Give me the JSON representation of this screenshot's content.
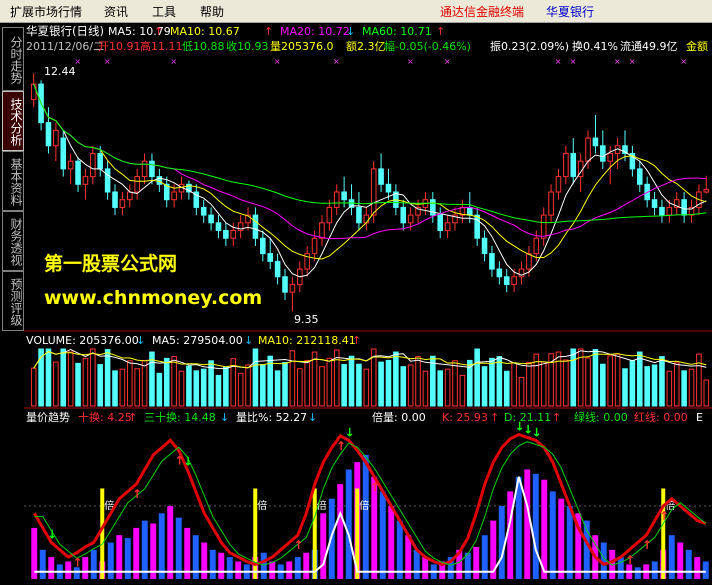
{
  "menu": {
    "items": [
      "扩展市场行情",
      "资讯",
      "工具",
      "帮助"
    ],
    "brand": "通达信金融终端",
    "stock_name": "华夏银行"
  },
  "side_tabs": [
    "分时走势",
    "技术分析",
    "基本资料",
    "财务透视",
    "预测评级"
  ],
  "price_panel": {
    "title": "华夏银行(日线)",
    "ma": [
      {
        "label": "MA5: 10.79",
        "color": "#ffffff"
      },
      {
        "label": "MA10: 10.67",
        "color": "#ffff00"
      },
      {
        "label": "MA20: 10.72",
        "color": "#ff00ff"
      },
      {
        "label": "MA60: 10.71",
        "color": "#00ff00"
      }
    ],
    "info": {
      "date": "2011/12/06/二",
      "open": "开10.91",
      "high": "高11.11",
      "low": "低10.88",
      "close": "收10.93",
      "volume": "量205376.0",
      "amount": "额2.3亿",
      "change": "幅-0.05(-0.46%)",
      "amplitude": "振0.23(2.09%)",
      "turnover": "换0.41%",
      "float": "流通49.9亿",
      "amount_label": "金额"
    },
    "high_marker": "12.44",
    "low_marker": "9.35",
    "watermark_line1": "第一股票公式网",
    "watermark_line2": "www.chnmoney.com"
  },
  "volume_panel": {
    "vol": "VOLUME: 205376.00",
    "ma5": "MA5: 279504.00",
    "ma10": "MA10: 212118.41"
  },
  "indicator_panel": {
    "name": "量价趋势",
    "shi_huan": "十换: 4.25",
    "sanshi_huan": "三十换: 14.48",
    "liang_bi": "量比%: 52.27",
    "bei_liang": "倍量: 0.00",
    "k": "K: 25.93",
    "d": "D: 21.11",
    "green_line": "绿线: 0.00",
    "red_line": "红线: 0.00",
    "tail": "E",
    "bei_marker": "倍"
  },
  "chart_data": {
    "type": "candlestick",
    "price_range": [
      9.2,
      12.6
    ],
    "candles": [
      [
        12.1,
        12.44,
        12.0,
        12.3
      ],
      [
        12.3,
        12.35,
        11.7,
        11.8
      ],
      [
        11.8,
        12.0,
        11.4,
        11.5
      ],
      [
        11.5,
        11.8,
        11.3,
        11.7
      ],
      [
        11.6,
        11.7,
        11.1,
        11.2
      ],
      [
        11.2,
        11.4,
        11.0,
        11.3
      ],
      [
        11.3,
        11.35,
        10.9,
        11.0
      ],
      [
        11.0,
        11.2,
        10.8,
        11.1
      ],
      [
        11.1,
        11.5,
        11.0,
        11.4
      ],
      [
        11.4,
        11.5,
        11.1,
        11.2
      ],
      [
        11.2,
        11.3,
        10.8,
        10.9
      ],
      [
        10.9,
        11.0,
        10.6,
        10.7
      ],
      [
        10.7,
        10.9,
        10.6,
        10.8
      ],
      [
        10.8,
        11.0,
        10.7,
        10.9
      ],
      [
        10.9,
        11.2,
        10.8,
        11.1
      ],
      [
        11.1,
        11.4,
        11.0,
        11.3
      ],
      [
        11.3,
        11.4,
        11.0,
        11.1
      ],
      [
        11.1,
        11.2,
        10.9,
        11.0
      ],
      [
        11.0,
        11.1,
        10.7,
        10.8
      ],
      [
        10.8,
        11.0,
        10.7,
        10.9
      ],
      [
        10.9,
        11.1,
        10.8,
        11.0
      ],
      [
        11.0,
        11.05,
        10.8,
        10.9
      ],
      [
        10.9,
        11.0,
        10.6,
        10.7
      ],
      [
        10.7,
        10.8,
        10.5,
        10.6
      ],
      [
        10.6,
        10.7,
        10.4,
        10.5
      ],
      [
        10.5,
        10.6,
        10.3,
        10.4
      ],
      [
        10.4,
        10.5,
        10.2,
        10.3
      ],
      [
        10.3,
        10.5,
        10.2,
        10.4
      ],
      [
        10.4,
        10.6,
        10.3,
        10.5
      ],
      [
        10.5,
        10.7,
        10.4,
        10.6
      ],
      [
        10.6,
        10.7,
        10.2,
        10.3
      ],
      [
        10.3,
        10.4,
        10.0,
        10.1
      ],
      [
        10.1,
        10.3,
        9.9,
        10.0
      ],
      [
        10.0,
        10.1,
        9.7,
        9.8
      ],
      [
        9.8,
        9.9,
        9.5,
        9.6
      ],
      [
        9.6,
        9.8,
        9.35,
        9.7
      ],
      [
        9.7,
        10.0,
        9.6,
        9.9
      ],
      [
        9.9,
        10.2,
        9.8,
        10.1
      ],
      [
        10.1,
        10.4,
        10.0,
        10.3
      ],
      [
        10.3,
        10.6,
        10.2,
        10.5
      ],
      [
        10.5,
        10.8,
        10.4,
        10.7
      ],
      [
        10.7,
        11.0,
        10.6,
        10.9
      ],
      [
        10.9,
        11.1,
        10.7,
        10.8
      ],
      [
        10.8,
        11.0,
        10.6,
        10.7
      ],
      [
        10.7,
        10.9,
        10.4,
        10.5
      ],
      [
        10.5,
        10.7,
        10.4,
        10.6
      ],
      [
        10.6,
        11.3,
        10.5,
        11.2
      ],
      [
        11.2,
        11.4,
        10.9,
        11.0
      ],
      [
        11.0,
        11.2,
        10.8,
        10.9
      ],
      [
        10.9,
        11.0,
        10.6,
        10.7
      ],
      [
        10.7,
        10.8,
        10.4,
        10.5
      ],
      [
        10.5,
        10.7,
        10.4,
        10.6
      ],
      [
        10.6,
        10.8,
        10.5,
        10.7
      ],
      [
        10.7,
        10.9,
        10.6,
        10.8
      ],
      [
        10.8,
        10.9,
        10.5,
        10.6
      ],
      [
        10.6,
        10.7,
        10.3,
        10.4
      ],
      [
        10.4,
        10.6,
        10.3,
        10.5
      ],
      [
        10.5,
        10.7,
        10.4,
        10.6
      ],
      [
        10.6,
        10.8,
        10.5,
        10.7
      ],
      [
        10.7,
        10.9,
        10.5,
        10.6
      ],
      [
        10.6,
        10.7,
        10.2,
        10.3
      ],
      [
        10.3,
        10.4,
        10.0,
        10.1
      ],
      [
        10.1,
        10.2,
        9.8,
        9.9
      ],
      [
        9.9,
        10.0,
        9.7,
        9.8
      ],
      [
        9.8,
        9.9,
        9.6,
        9.7
      ],
      [
        9.7,
        9.9,
        9.6,
        9.8
      ],
      [
        9.8,
        10.0,
        9.7,
        9.9
      ],
      [
        9.9,
        10.2,
        9.8,
        10.1
      ],
      [
        10.1,
        10.4,
        10.0,
        10.3
      ],
      [
        10.3,
        10.7,
        10.2,
        10.6
      ],
      [
        10.6,
        11.0,
        10.5,
        10.9
      ],
      [
        10.9,
        11.2,
        10.8,
        11.1
      ],
      [
        11.1,
        11.5,
        11.0,
        11.4
      ],
      [
        11.4,
        11.6,
        11.0,
        11.1
      ],
      [
        11.1,
        11.4,
        10.9,
        11.3
      ],
      [
        11.3,
        11.7,
        11.2,
        11.6
      ],
      [
        11.6,
        11.9,
        11.4,
        11.5
      ],
      [
        11.5,
        11.7,
        11.2,
        11.3
      ],
      [
        11.3,
        11.5,
        11.0,
        11.4
      ],
      [
        11.4,
        11.6,
        11.2,
        11.5
      ],
      [
        11.5,
        11.7,
        11.3,
        11.4
      ],
      [
        11.4,
        11.5,
        11.1,
        11.2
      ],
      [
        11.2,
        11.3,
        10.9,
        11.0
      ],
      [
        11.0,
        11.1,
        10.7,
        10.8
      ],
      [
        10.8,
        10.9,
        10.6,
        10.7
      ],
      [
        10.7,
        10.8,
        10.5,
        10.6
      ],
      [
        10.6,
        10.8,
        10.5,
        10.7
      ],
      [
        10.7,
        10.9,
        10.6,
        10.8
      ],
      [
        10.8,
        10.9,
        10.5,
        10.6
      ],
      [
        10.6,
        10.8,
        10.5,
        10.7
      ],
      [
        10.7,
        11.0,
        10.6,
        10.9
      ],
      [
        10.9,
        11.11,
        10.88,
        10.93
      ]
    ],
    "volume_max": 600000,
    "indicator": {
      "bars": [
        [
          2,
          0.35
        ],
        [
          1,
          0.2
        ],
        [
          2,
          0.15
        ],
        [
          1,
          0.1
        ],
        [
          2,
          0.12
        ],
        [
          1,
          0.08
        ],
        [
          2,
          0.15
        ],
        [
          1,
          0.2
        ],
        [
          2,
          0.12
        ],
        [
          1,
          0.25
        ],
        [
          2,
          0.3
        ],
        [
          1,
          0.28
        ],
        [
          2,
          0.35
        ],
        [
          1,
          0.4
        ],
        [
          2,
          0.38
        ],
        [
          1,
          0.45
        ],
        [
          2,
          0.5
        ],
        [
          1,
          0.42
        ],
        [
          2,
          0.35
        ],
        [
          1,
          0.3
        ],
        [
          2,
          0.25
        ],
        [
          1,
          0.2
        ],
        [
          2,
          0.18
        ],
        [
          1,
          0.15
        ],
        [
          2,
          0.12
        ],
        [
          1,
          0.1
        ],
        [
          2,
          0.15
        ],
        [
          1,
          0.18
        ],
        [
          2,
          0.12
        ],
        [
          1,
          0.1
        ],
        [
          2,
          0.12
        ],
        [
          1,
          0.15
        ],
        [
          2,
          0.18
        ],
        [
          1,
          0.2
        ],
        [
          2,
          0.45
        ],
        [
          1,
          0.55
        ],
        [
          2,
          0.65
        ],
        [
          1,
          0.75
        ],
        [
          2,
          0.8
        ],
        [
          1,
          0.85
        ],
        [
          2,
          0.7
        ],
        [
          1,
          0.6
        ],
        [
          2,
          0.5
        ],
        [
          1,
          0.4
        ],
        [
          2,
          0.3
        ],
        [
          1,
          0.2
        ],
        [
          2,
          0.15
        ],
        [
          1,
          0.1
        ],
        [
          2,
          0.12
        ],
        [
          1,
          0.15
        ],
        [
          2,
          0.2
        ],
        [
          1,
          0.18
        ],
        [
          2,
          0.22
        ],
        [
          1,
          0.3
        ],
        [
          2,
          0.4
        ],
        [
          1,
          0.5
        ],
        [
          2,
          0.6
        ],
        [
          1,
          0.7
        ],
        [
          2,
          0.75
        ],
        [
          1,
          0.72
        ],
        [
          2,
          0.68
        ],
        [
          1,
          0.6
        ],
        [
          2,
          0.55
        ],
        [
          1,
          0.5
        ],
        [
          2,
          0.45
        ],
        [
          1,
          0.4
        ],
        [
          2,
          0.3
        ],
        [
          1,
          0.25
        ],
        [
          2,
          0.2
        ],
        [
          1,
          0.15
        ],
        [
          2,
          0.1
        ],
        [
          1,
          0.08
        ],
        [
          2,
          0.1
        ],
        [
          1,
          0.12
        ],
        [
          2,
          0.2
        ],
        [
          1,
          0.3
        ],
        [
          2,
          0.25
        ],
        [
          1,
          0.2
        ],
        [
          2,
          0.15
        ],
        [
          1,
          0.12
        ]
      ],
      "red_line": [
        0.45,
        0.35,
        0.25,
        0.2,
        0.15,
        0.18,
        0.22,
        0.25,
        0.35,
        0.45,
        0.55,
        0.6,
        0.65,
        0.75,
        0.85,
        0.9,
        0.95,
        0.88,
        0.75,
        0.6,
        0.45,
        0.35,
        0.25,
        0.18,
        0.15,
        0.12,
        0.1,
        0.12,
        0.15,
        0.2,
        0.25,
        0.3,
        0.45,
        0.65,
        0.8,
        0.9,
        0.98,
        0.95,
        0.88,
        0.8,
        0.7,
        0.6,
        0.5,
        0.4,
        0.3,
        0.2,
        0.15,
        0.12,
        0.1,
        0.12,
        0.18,
        0.28,
        0.45,
        0.65,
        0.8,
        0.9,
        0.96,
        0.99,
        0.97,
        0.95,
        0.9,
        0.8,
        0.65,
        0.5,
        0.35,
        0.25,
        0.15,
        0.1,
        0.12,
        0.15,
        0.2,
        0.25,
        0.3,
        0.4,
        0.5,
        0.55,
        0.5,
        0.45,
        0.4,
        0.38
      ],
      "white_line": [
        0.05,
        0.05,
        0.05,
        0.05,
        0.05,
        0.05,
        0.05,
        0.05,
        0.05,
        0.05,
        0.05,
        0.05,
        0.05,
        0.05,
        0.05,
        0.05,
        0.05,
        0.05,
        0.05,
        0.05,
        0.05,
        0.05,
        0.05,
        0.05,
        0.05,
        0.05,
        0.05,
        0.05,
        0.05,
        0.05,
        0.05,
        0.05,
        0.05,
        0.05,
        0.1,
        0.3,
        0.45,
        0.3,
        0.05,
        0.05,
        0.05,
        0.05,
        0.05,
        0.05,
        0.05,
        0.05,
        0.05,
        0.05,
        0.05,
        0.05,
        0.05,
        0.05,
        0.05,
        0.05,
        0.05,
        0.15,
        0.4,
        0.7,
        0.5,
        0.2,
        0.05,
        0.05,
        0.05,
        0.05,
        0.05,
        0.05,
        0.05,
        0.05,
        0.05,
        0.05,
        0.05,
        0.05,
        0.05,
        0.05,
        0.05,
        0.05,
        0.05,
        0.05,
        0.05,
        0.05
      ],
      "bei_positions": [
        8,
        26,
        33,
        38,
        74
      ],
      "down_arrows": [
        2,
        18,
        37,
        57,
        58,
        59
      ],
      "up_arrows": [
        5,
        12,
        17,
        31,
        36,
        40,
        70,
        72,
        74
      ]
    }
  }
}
